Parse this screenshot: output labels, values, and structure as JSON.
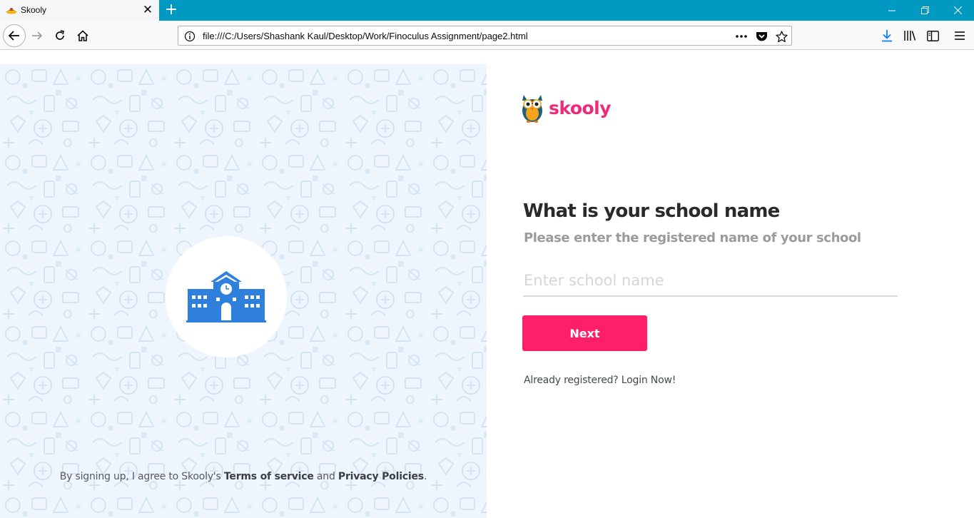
{
  "browser": {
    "tab_title": "Skooly",
    "url": "file:///C:/Users/Shashank Kaul/Desktop/Work/Finoculus Assignment/page2.html",
    "accent_color": "#0099c2"
  },
  "brand": {
    "name": "skooly",
    "color": "#ee2a7b"
  },
  "form": {
    "heading": "What is your school name",
    "subheading": "Please enter the registered name of your school",
    "input_placeholder": "Enter school name",
    "input_value": "",
    "next_label": "Next",
    "next_color": "#ff1f68",
    "login_text": "Already registered? Login Now!"
  },
  "legal": {
    "prefix": "By signing up, I agree to Skooly's ",
    "terms": "Terms of service",
    "and": " and ",
    "privacy": "Privacy Policies",
    "suffix": "."
  },
  "icons": {
    "hero": "school-building-icon",
    "mascot": "owl-icon"
  }
}
